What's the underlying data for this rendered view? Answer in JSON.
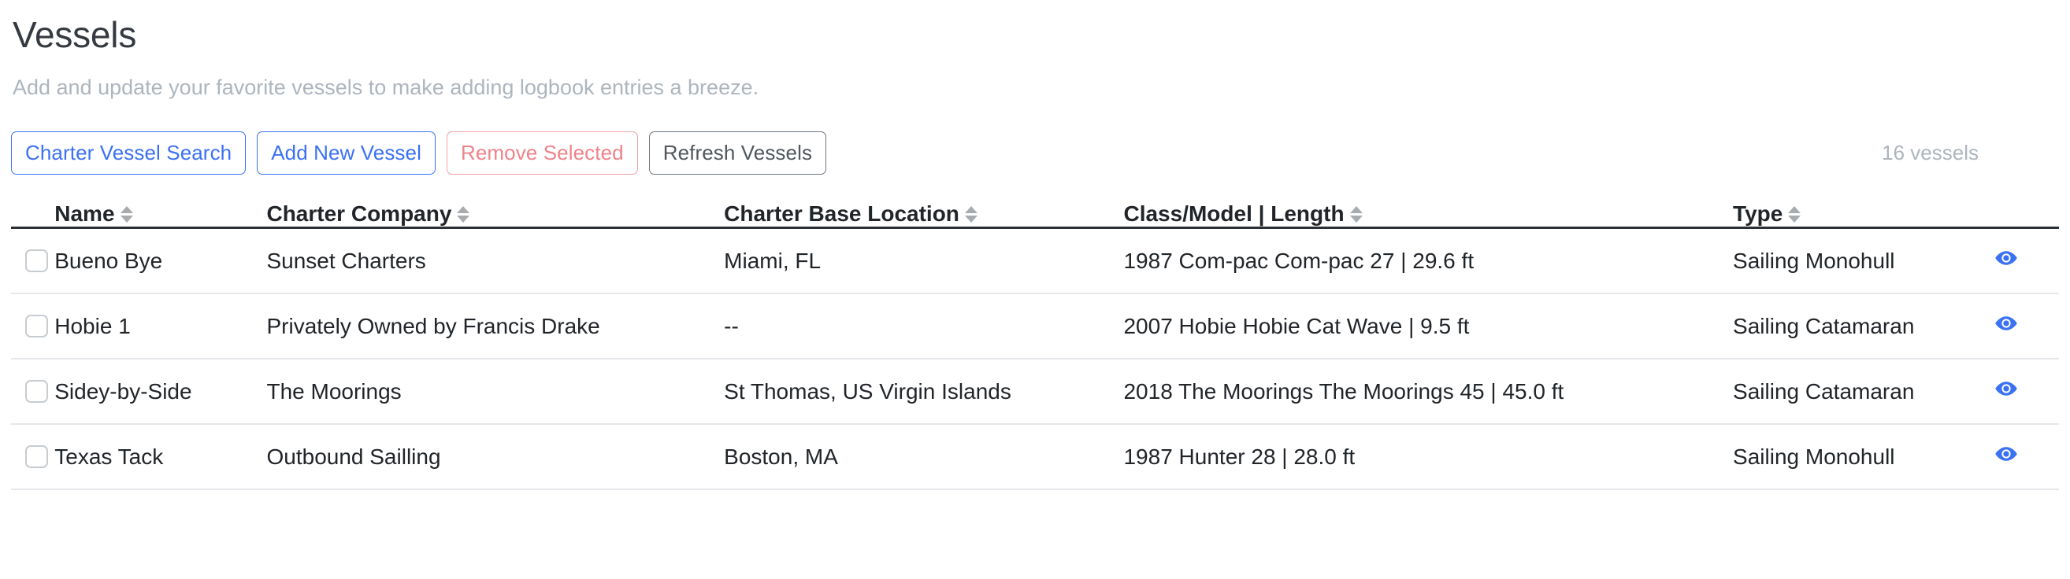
{
  "header": {
    "title": "Vessels",
    "subtitle": "Add and update your favorite vessels to make adding logbook entries a breeze."
  },
  "toolbar": {
    "charter_vessel_search_label": "Charter Vessel Search",
    "add_new_vessel_label": "Add New Vessel",
    "remove_selected_label": "Remove Selected",
    "refresh_vessels_label": "Refresh Vessels",
    "vessel_count": "16 vessels",
    "colors": {
      "primary": "#3b71f3",
      "danger": "#ef8389",
      "secondary": "#6c757d",
      "muted": "#adb5bd"
    }
  },
  "table": {
    "columns": [
      {
        "key": "name",
        "label": "Name",
        "sortable": true
      },
      {
        "key": "company",
        "label": "Charter Company",
        "sortable": true
      },
      {
        "key": "base",
        "label": "Charter Base Location",
        "sortable": true
      },
      {
        "key": "class",
        "label": "Class/Model | Length",
        "sortable": true
      },
      {
        "key": "type",
        "label": "Type",
        "sortable": true
      }
    ],
    "sort_icon": "sort-updown-icon",
    "row_action_icon": "eye-icon",
    "row_action_color": "#3b71f3",
    "rows": [
      {
        "selected": false,
        "name": "Bueno Bye",
        "company": "Sunset Charters",
        "base": "Miami, FL",
        "class": "1987 Com-pac Com-pac 27 | 29.6 ft",
        "type": "Sailing Monohull"
      },
      {
        "selected": false,
        "name": "Hobie 1",
        "company": "Privately Owned by Francis Drake",
        "base": "--",
        "class": "2007 Hobie Hobie Cat Wave | 9.5 ft",
        "type": "Sailing Catamaran"
      },
      {
        "selected": false,
        "name": "Sidey-by-Side",
        "company": "The Moorings",
        "base": "St Thomas, US Virgin Islands",
        "class": "2018 The Moorings The Moorings 45 | 45.0 ft",
        "type": "Sailing Catamaran"
      },
      {
        "selected": false,
        "name": "Texas Tack",
        "company": "Outbound Sailling",
        "base": "Boston, MA",
        "class": "1987 Hunter 28 | 28.0 ft",
        "type": "Sailing Monohull"
      }
    ]
  }
}
